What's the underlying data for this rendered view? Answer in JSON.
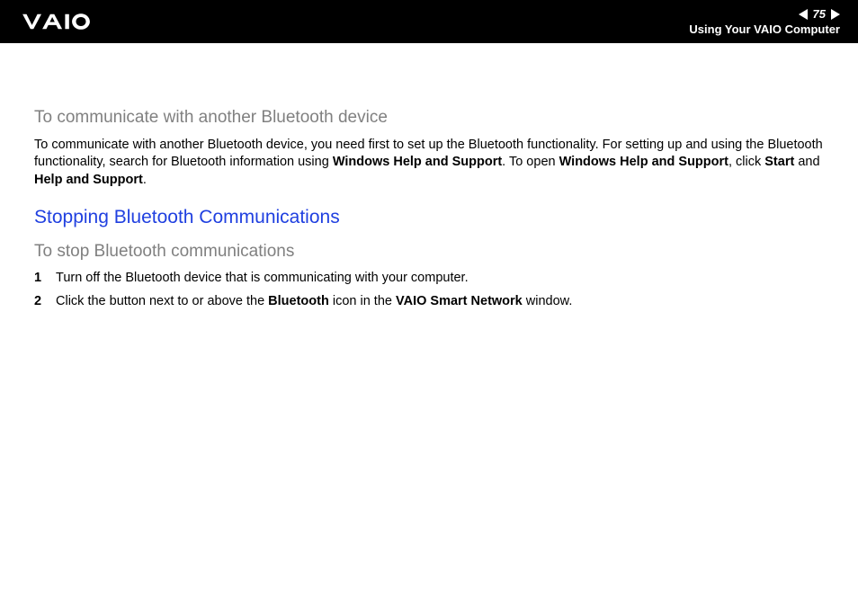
{
  "header": {
    "page_number": "75",
    "section_title": "Using Your VAIO Computer"
  },
  "content": {
    "sub1": "To communicate with another Bluetooth device",
    "p1_a": "To communicate with another Bluetooth device, you need first to set up the Bluetooth functionality. For setting up and using the Bluetooth functionality, search for Bluetooth information using ",
    "p1_b1": "Windows Help and Support",
    "p1_c": ". To open ",
    "p1_b2": "Windows Help and Support",
    "p1_d": ", click ",
    "p1_b3": "Start",
    "p1_e": " and ",
    "p1_b4": "Help and Support",
    "p1_f": ".",
    "h2": "Stopping Bluetooth Communications",
    "sub2": "To stop Bluetooth communications",
    "step1_num": "1",
    "step1_text": "Turn off the Bluetooth device that is communicating with your computer.",
    "step2_num": "2",
    "step2_a": "Click the button next to or above the ",
    "step2_b1": "Bluetooth",
    "step2_b": " icon in the ",
    "step2_b2": "VAIO Smart Network",
    "step2_c": " window."
  }
}
